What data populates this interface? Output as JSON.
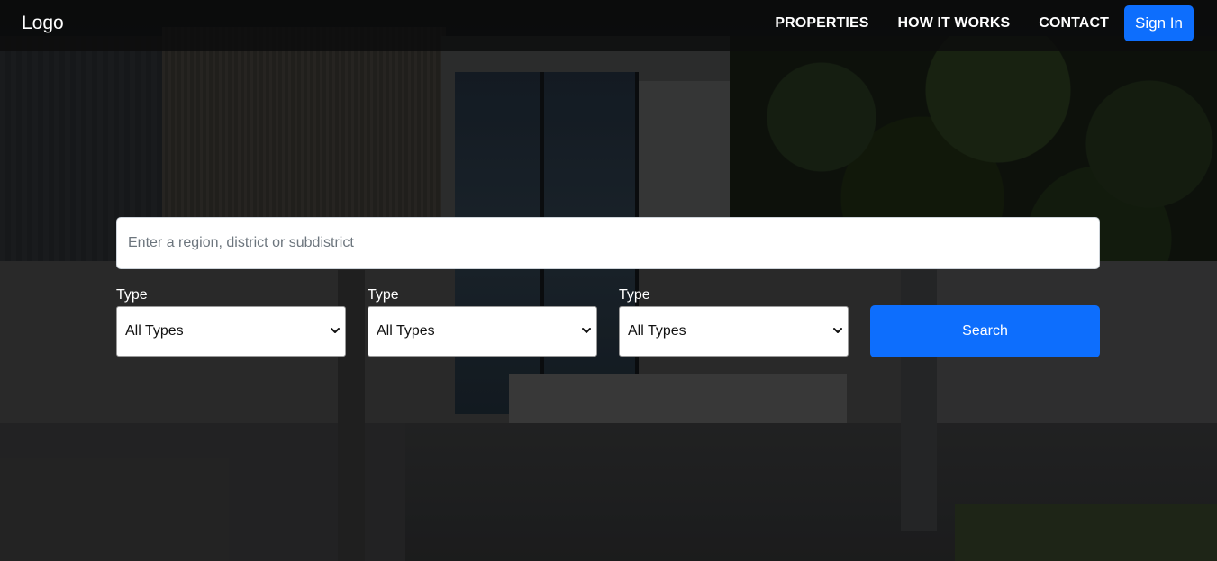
{
  "nav": {
    "logo": "Logo",
    "links": [
      {
        "label": "PROPERTIES"
      },
      {
        "label": "HOW IT WORKS"
      },
      {
        "label": "CONTACT"
      }
    ],
    "signin_label": "Sign In"
  },
  "search": {
    "placeholder": "Enter a region, district or subdistrict",
    "value": "",
    "filters": [
      {
        "label": "Type",
        "selected": "All Types",
        "icon": "chevron-down-icon"
      },
      {
        "label": "Type",
        "selected": "All Types",
        "icon": "chevron-down-icon"
      },
      {
        "label": "Type",
        "selected": "All Types",
        "icon": "chevron-down-icon"
      }
    ],
    "button_label": "Search"
  },
  "colors": {
    "accent": "#0d6efd",
    "navbar_bg": "#0c0c0c"
  }
}
